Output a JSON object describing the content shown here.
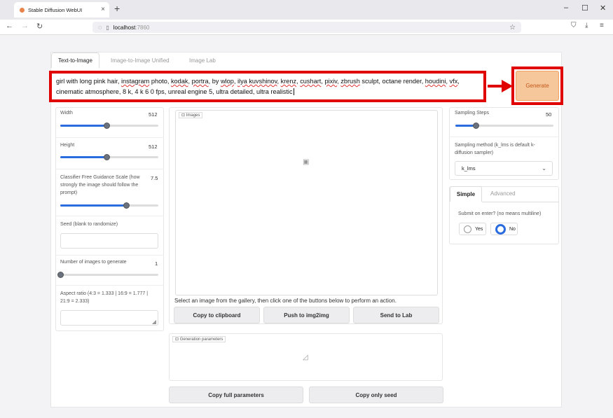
{
  "browser": {
    "tab_title": "Stable Diffusion WebUI",
    "url_host": "localhost",
    "url_port": ":7860"
  },
  "tabs": [
    "Text-to-Image",
    "Image-to-Image Unified",
    "Image Lab"
  ],
  "prompt": {
    "segments": [
      {
        "t": "girl with long pink hair, "
      },
      {
        "t": "instagram",
        "u": true
      },
      {
        "t": " photo, "
      },
      {
        "t": "kodak",
        "u": true
      },
      {
        "t": ", "
      },
      {
        "t": "portra",
        "u": true
      },
      {
        "t": ", by "
      },
      {
        "t": "wlop",
        "u": true
      },
      {
        "t": ", "
      },
      {
        "t": "ilya kuvshinov",
        "u": true
      },
      {
        "t": ", "
      },
      {
        "t": "krenz",
        "u": true
      },
      {
        "t": ", "
      },
      {
        "t": "cushart",
        "u": true
      },
      {
        "t": ", "
      },
      {
        "t": "pixiv",
        "u": true
      },
      {
        "t": ", "
      },
      {
        "t": "zbrush",
        "u": true
      },
      {
        "t": " sculpt, octane render, "
      },
      {
        "t": "houdini",
        "u": true
      },
      {
        "t": ", "
      },
      {
        "t": "vfx",
        "u": true
      },
      {
        "t": ", cinematic atmosphere, 8 k, 4 k 6 0 fps, unreal engine 5, ultra detailed, ultra realistic"
      }
    ]
  },
  "generate_label": "Generate",
  "left": {
    "width_label": "Width",
    "width_value": "512",
    "width_level": 0.47,
    "height_label": "Height",
    "height_value": "512",
    "height_level": 0.47,
    "cfg_label": "Classifier Free Guidance Scale (how strongly the image should follow the prompt)",
    "cfg_value": "7.5",
    "cfg_level": 0.67,
    "seed_label": "Seed (blank to randomize)",
    "num_label": "Number of images to generate",
    "num_value": "1",
    "num_level": 0.0,
    "aspect_label": "Aspect ratio (4:3 = 1.333 | 16:9 = 1.777 | 21:9 = 2.333)"
  },
  "center": {
    "images_label": "Images",
    "hint": "Select an image from the gallery, then click one of the buttons below to perform an action.",
    "buttons": [
      "Copy to clipboard",
      "Push to img2img",
      "Send to Lab"
    ],
    "gen_params_label": "Generation parameters",
    "bottom_buttons": [
      "Copy full parameters",
      "Copy only seed"
    ]
  },
  "right": {
    "steps_label": "Sampling Steps",
    "steps_value": "50",
    "steps_level": 0.21,
    "sampler_label": "Sampling method (k_lms is default k-diffusion sampler)",
    "sampler_value": "k_lms",
    "tabs": [
      "Simple",
      "Advanced"
    ],
    "submit_label": "Submit on enter? (no means multiline)",
    "yes": "Yes",
    "no": "No"
  }
}
